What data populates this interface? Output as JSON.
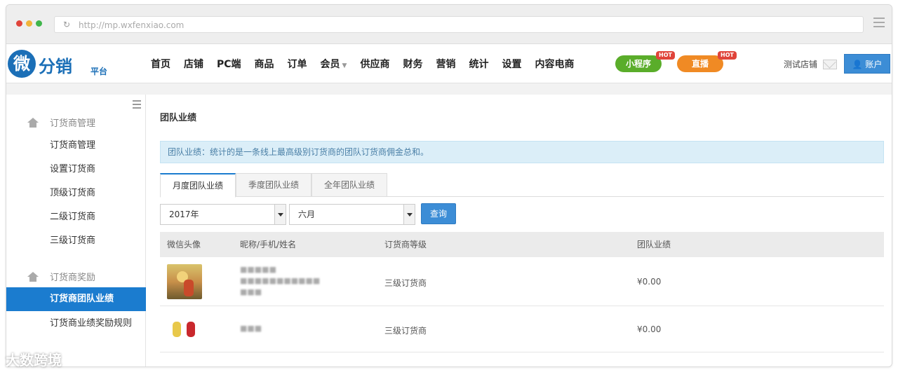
{
  "browser": {
    "url": "http://mp.wxfenxiao.com",
    "dot_colors": [
      "#e0443a",
      "#f0b43a",
      "#3fb54a"
    ]
  },
  "logo": {
    "icon_char": "微",
    "text": "分销",
    "sub": "平台"
  },
  "nav": {
    "items": [
      {
        "label": "首页"
      },
      {
        "label": "店铺"
      },
      {
        "label": "PC端"
      },
      {
        "label": "商品"
      },
      {
        "label": "订单"
      },
      {
        "label": "会员",
        "dropdown": true
      },
      {
        "label": "供应商"
      },
      {
        "label": "财务"
      },
      {
        "label": "营销"
      },
      {
        "label": "统计"
      },
      {
        "label": "设置"
      },
      {
        "label": "内容电商"
      }
    ],
    "mini_program": {
      "label": "小程序",
      "badge": "HOT",
      "color": "#5aad2a"
    },
    "live": {
      "label": "直播",
      "badge": "HOT",
      "color": "#f08a24"
    },
    "shop_name": "测试店铺",
    "account_label": "账户"
  },
  "sidebar": {
    "groups": [
      {
        "title": "订货商管理",
        "items": [
          {
            "label": "订货商管理"
          },
          {
            "label": "设置订货商"
          },
          {
            "label": "顶级订货商"
          },
          {
            "label": "二级订货商"
          },
          {
            "label": "三级订货商"
          }
        ]
      },
      {
        "title": "订货商奖励",
        "items": [
          {
            "label": "订货商团队业绩",
            "active": true
          },
          {
            "label": "订货商业绩奖励规则"
          }
        ]
      }
    ]
  },
  "main": {
    "title": "团队业绩",
    "notice": "团队业绩：统计的是一条线上最高级别订货商的团队订货商佣金总和。",
    "tabs": [
      {
        "label": "月度团队业绩",
        "active": true
      },
      {
        "label": "季度团队业绩"
      },
      {
        "label": "全年团队业绩"
      }
    ],
    "filters": {
      "year": "2017年",
      "month": "六月",
      "query_label": "查询"
    },
    "table": {
      "headers": [
        "微信头像",
        "昵称/手机/姓名",
        "订货商等级",
        "团队业绩"
      ],
      "rows": [
        {
          "name_lines": [
            "■■■■■",
            "■■■■■■■■■■■",
            "■■■"
          ],
          "level": "三级订货商",
          "amount": "¥0.00"
        },
        {
          "name_lines": [
            "■■■"
          ],
          "level": "三级订货商",
          "amount": "¥0.00"
        }
      ]
    }
  },
  "watermark": "大数跨境"
}
